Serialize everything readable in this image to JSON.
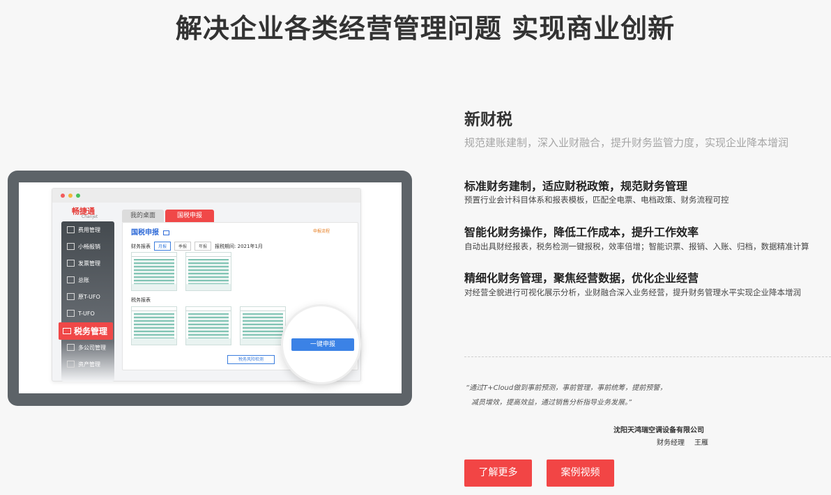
{
  "page": {
    "headline": "解决企业各类经营管理问题  实现商业创新"
  },
  "product_shot": {
    "brand_cn": "畅捷通",
    "brand_en": "Chanjet",
    "sidebar_items": [
      {
        "label": "费用管理",
        "icon": "expense-icon"
      },
      {
        "label": "小畅报销",
        "icon": "reimburse-icon"
      },
      {
        "label": "发票管理",
        "icon": "invoice-icon"
      },
      {
        "label": "总账",
        "icon": "ledger-icon"
      },
      {
        "label": "原T-UFO",
        "icon": "report-icon"
      },
      {
        "label": "T-UFO",
        "icon": "report-icon"
      },
      {
        "label": "多公司管理",
        "icon": "building-icon"
      },
      {
        "label": "资产管理",
        "icon": "asset-icon"
      }
    ],
    "sidebar_active": "税务管理",
    "tabs": [
      "我的桌面",
      "国税申报"
    ],
    "panel_title": "国税申报",
    "panel_flow": "申报流程",
    "report_label": "财务报表",
    "period_pills": [
      "月报",
      "季报",
      "年报"
    ],
    "tax_period": "报税期间: 2021年1月",
    "tax_reports_label": "税务报表",
    "risk_button": "税务风险检测",
    "one_click": "一键申报"
  },
  "section": {
    "title": "新财税",
    "subtitle": "规范建账建制，深入业财融合，提升财务监管力度，实现企业降本增润"
  },
  "features": [
    {
      "heading": "标准财务建制，适应财税政策，规范财务管理",
      "desc": "预置行业会计科目体系和报表模板，匹配全电票、电档政策、财务流程可控"
    },
    {
      "heading": "智能化财务操作，降低工作成本，提升工作效率",
      "desc": "自动出具财经报表，税务检测一键报税，效率倍增；智能识票、报销、入账、归档，数据精准计算"
    },
    {
      "heading": "精细化财务管理，聚焦经营数据，优化企业经营",
      "desc": "对经营全貌进行可视化展示分析，业财融合深入业务经营，提升财务管理水平实现企业降本增润"
    }
  ],
  "testimonial": {
    "line1": "“通过T+Cloud做到事前预测，事前管理，事前统筹，提前预警，",
    "line2": "减员增效，提高效益，通过销售分析指导业务发展。”",
    "company": "沈阳天鸿瑞空调设备有限公司",
    "role": "财务经理",
    "name": "王雁"
  },
  "buttons": {
    "learn_more": "了解更多",
    "case_video": "案例视频"
  },
  "colors": {
    "accent_red": "#f24545",
    "accent_blue": "#3b82e6",
    "frame_gray": "#5d6368"
  }
}
